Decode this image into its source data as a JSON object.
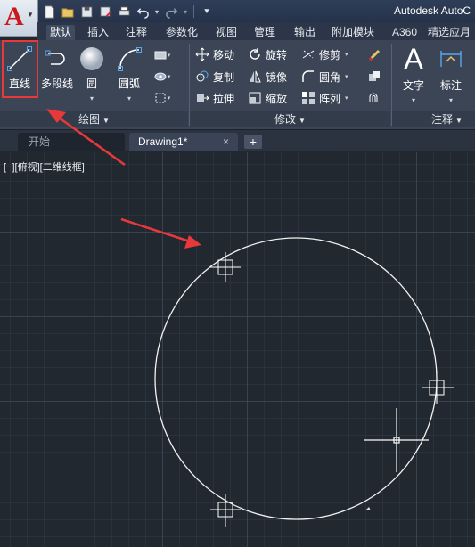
{
  "app": {
    "title": "Autodesk AutoC"
  },
  "ribbon_tabs": [
    "默认",
    "插入",
    "注释",
    "参数化",
    "视图",
    "管理",
    "输出",
    "附加模块",
    "A360",
    "精选应月"
  ],
  "panels": {
    "draw": {
      "title": "绘图",
      "tools": {
        "line": "直线",
        "polyline": "多段线",
        "circle": "圆",
        "arc": "圆弧"
      }
    },
    "modify": {
      "title": "修改",
      "tools": {
        "move": "移动",
        "rotate": "旋转",
        "trim": "修剪",
        "copy": "复制",
        "mirror": "镜像",
        "fillet": "圆角",
        "stretch": "拉伸",
        "scale": "缩放",
        "array": "阵列"
      }
    },
    "annotation": {
      "title": "注释",
      "tools": {
        "text": "文字",
        "dimension": "标注"
      }
    }
  },
  "doc_tabs": {
    "start": "开始",
    "drawing": "Drawing1*",
    "close": "×",
    "new": "+"
  },
  "viewport_label": "[−][俯视][二维线框]",
  "colors": {
    "accent_red": "#e8383a",
    "canvas_bg": "#212830",
    "ribbon_bg": "#3b4556"
  },
  "icons": {
    "app_menu": "autocad-logo-icon",
    "annotation_marker": "red-arrow-icon",
    "snap_marker": "grip-square-icon",
    "cursor": "crosshair-cursor-icon"
  }
}
